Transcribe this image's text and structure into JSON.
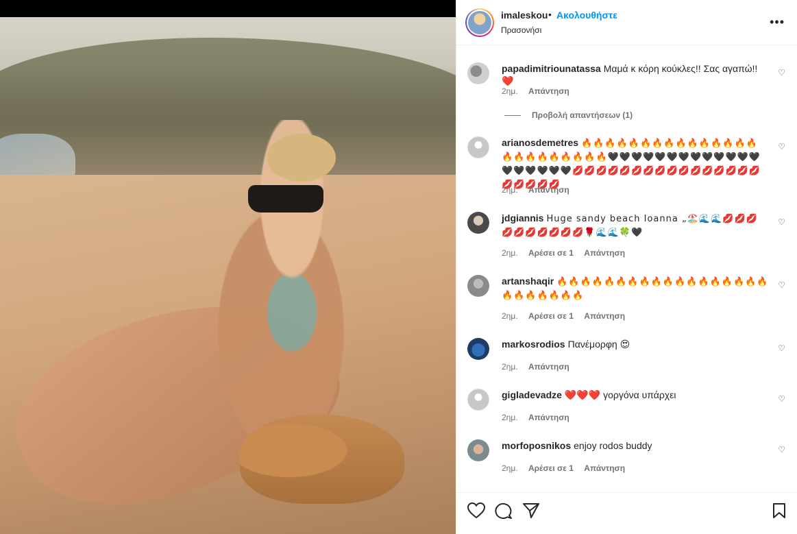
{
  "header": {
    "username": "imaleskou",
    "dot": "•",
    "follow_label": "Ακολουθήστε",
    "location": "Πρασονήσι",
    "more_label": "•••"
  },
  "comments": [
    {
      "user": "papadimitriounatassa",
      "text": "Μαμά κ κόρη κούκλες!! Σας αγαπώ!!❤️",
      "time": "2ημ.",
      "likes": "",
      "reply": "Απάντηση",
      "avatar": "photo-gray"
    },
    {
      "user": "arianosdemetres",
      "text": "🔥🔥🔥🔥🔥🔥🔥🔥🔥🔥🔥🔥🔥🔥🔥🔥🔥🔥🔥🔥🔥🔥🔥🔥🖤🖤🖤🖤🖤🖤🖤🖤🖤🖤🖤🖤🖤🖤🖤🖤🖤🖤🖤💋💋💋💋💋💋💋💋💋💋💋💋💋💋💋💋💋💋💋💋💋",
      "time": "2ημ.",
      "likes": "",
      "reply": "Απάντηση",
      "avatar": "default"
    },
    {
      "user": "jdgiannis",
      "text": "Huge sandy beach Ioanna „🏖️🌊🌊💋💋💋💋💋💋💋💋💋💋🌹🌊🌊🍀🖤",
      "time": "2ημ.",
      "likes": "Αρέσει σε 1",
      "reply": "Απάντηση",
      "avatar": "photo-dark"
    },
    {
      "user": "artanshaqir",
      "text": "🔥🔥🔥🔥🔥🔥🔥🔥🔥🔥🔥🔥🔥🔥🔥🔥🔥🔥🔥🔥🔥🔥🔥🔥🔥",
      "time": "2ημ.",
      "likes": "Αρέσει σε 1",
      "reply": "Απάντηση",
      "avatar": "photo-gray"
    },
    {
      "user": "markosrodios",
      "text": "Πανέμορφη 😍",
      "time": "2ημ.",
      "likes": "",
      "reply": "Απάντηση",
      "avatar": "photo-blue"
    },
    {
      "user": "gigladevadze",
      "text": "❤️❤️❤️ γοργόνα υπάρχει",
      "time": "2ημ.",
      "likes": "",
      "reply": "Απάντηση",
      "avatar": "default"
    },
    {
      "user": "morfoposnikos",
      "text": "enjoy rodos buddy",
      "time": "2ημ.",
      "likes": "Αρέσει σε 1",
      "reply": "Απάντηση",
      "avatar": "photo-light"
    }
  ],
  "view_replies": "Προβολή απαντήσεων (1)",
  "actions": {
    "like_icon": "heart-icon",
    "comment_icon": "comment-icon",
    "share_icon": "share-icon",
    "save_icon": "bookmark-icon"
  },
  "colors": {
    "accent": "#0095f6",
    "text": "#262626",
    "muted": "#737373"
  }
}
